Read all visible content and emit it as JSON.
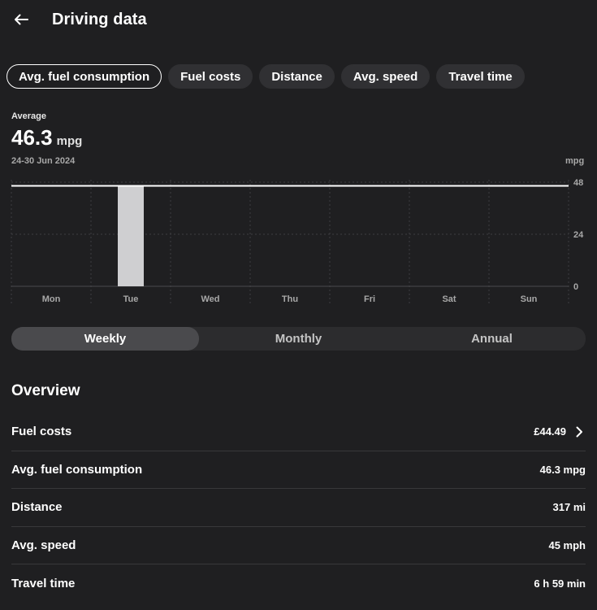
{
  "header": {
    "title": "Driving data",
    "back_icon": "arrow-left-icon"
  },
  "metric_tabs": [
    {
      "label": "Avg. fuel consumption",
      "active": true
    },
    {
      "label": "Fuel costs",
      "active": false
    },
    {
      "label": "Distance",
      "active": false
    },
    {
      "label": "Avg. speed",
      "active": false
    },
    {
      "label": "Travel time",
      "active": false
    }
  ],
  "summary": {
    "label": "Average",
    "value": "46.3",
    "unit": "mpg",
    "date_range": "24-30 Jun 2024",
    "axis_unit": "mpg"
  },
  "chart_data": {
    "type": "bar",
    "categories": [
      "Mon",
      "Tue",
      "Wed",
      "Thu",
      "Fri",
      "Sat",
      "Sun"
    ],
    "values": [
      null,
      46.3,
      null,
      null,
      null,
      null,
      null
    ],
    "average": 46.3,
    "ylim": [
      0,
      48
    ],
    "yticks": [
      0,
      24,
      48
    ],
    "grid": true,
    "colors": {
      "bar": "#cfcfd1",
      "average_line": "#ffffff",
      "grid": "#3e3e41"
    }
  },
  "period_tabs": [
    {
      "label": "Weekly",
      "active": true
    },
    {
      "label": "Monthly",
      "active": false
    },
    {
      "label": "Annual",
      "active": false
    }
  ],
  "overview": {
    "title": "Overview",
    "rows": [
      {
        "label": "Fuel costs",
        "value": "£44.49",
        "has_chevron": true
      },
      {
        "label": "Avg. fuel consumption",
        "value": "46.3 mpg",
        "has_chevron": false
      },
      {
        "label": "Distance",
        "value": "317 mi",
        "has_chevron": false
      },
      {
        "label": "Avg. speed",
        "value": "45 mph",
        "has_chevron": false
      },
      {
        "label": "Travel time",
        "value": "6 h 59 min",
        "has_chevron": false
      }
    ]
  }
}
